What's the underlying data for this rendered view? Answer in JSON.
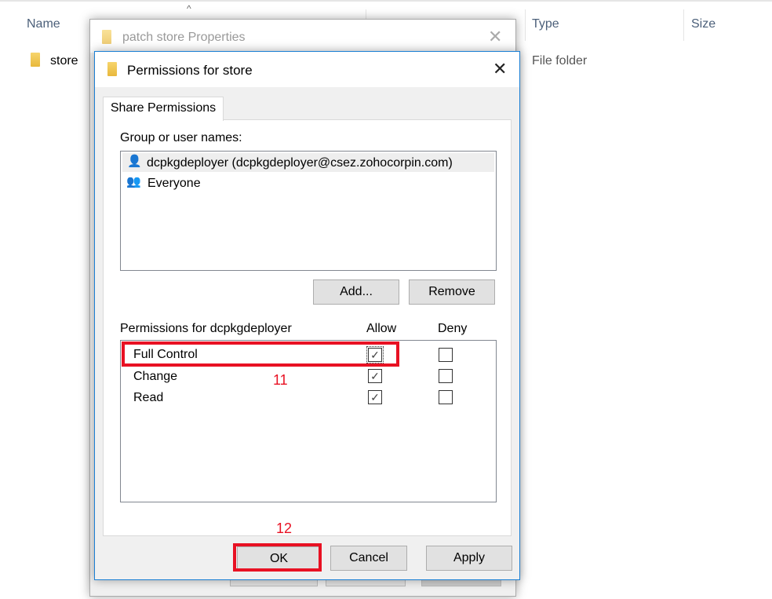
{
  "explorer": {
    "columns": [
      "Name",
      "Type",
      "Size"
    ],
    "sort_icon": "caret-up-icon",
    "rows": [
      {
        "name": "store",
        "type": "File folder"
      }
    ]
  },
  "back_dialog": {
    "title": "patch store Properties",
    "close_icon": "close-icon"
  },
  "dialog": {
    "title": "Permissions for store",
    "close_icon": "close-icon",
    "tab": "Share Permissions",
    "group_label": "Group or user names:",
    "users": [
      {
        "name": "dcpkgdeployer (dcpkgdeployer@csez.zohocorpin.com)",
        "icon": "user-icon",
        "selected": true
      },
      {
        "name": "Everyone",
        "icon": "users-group-icon",
        "selected": false
      }
    ],
    "add_label": "Add...",
    "remove_label": "Remove",
    "permissions_label": "Permissions for dcpkgdeployer",
    "allow_label": "Allow",
    "deny_label": "Deny",
    "permissions": [
      {
        "name": "Full Control",
        "allow": true,
        "deny": false
      },
      {
        "name": "Change",
        "allow": true,
        "deny": false
      },
      {
        "name": "Read",
        "allow": true,
        "deny": false
      }
    ],
    "ok_label": "OK",
    "cancel_label": "Cancel",
    "apply_label": "Apply"
  },
  "annotations": {
    "step1": "11",
    "step2": "12",
    "highlight_color": "#e81123"
  }
}
